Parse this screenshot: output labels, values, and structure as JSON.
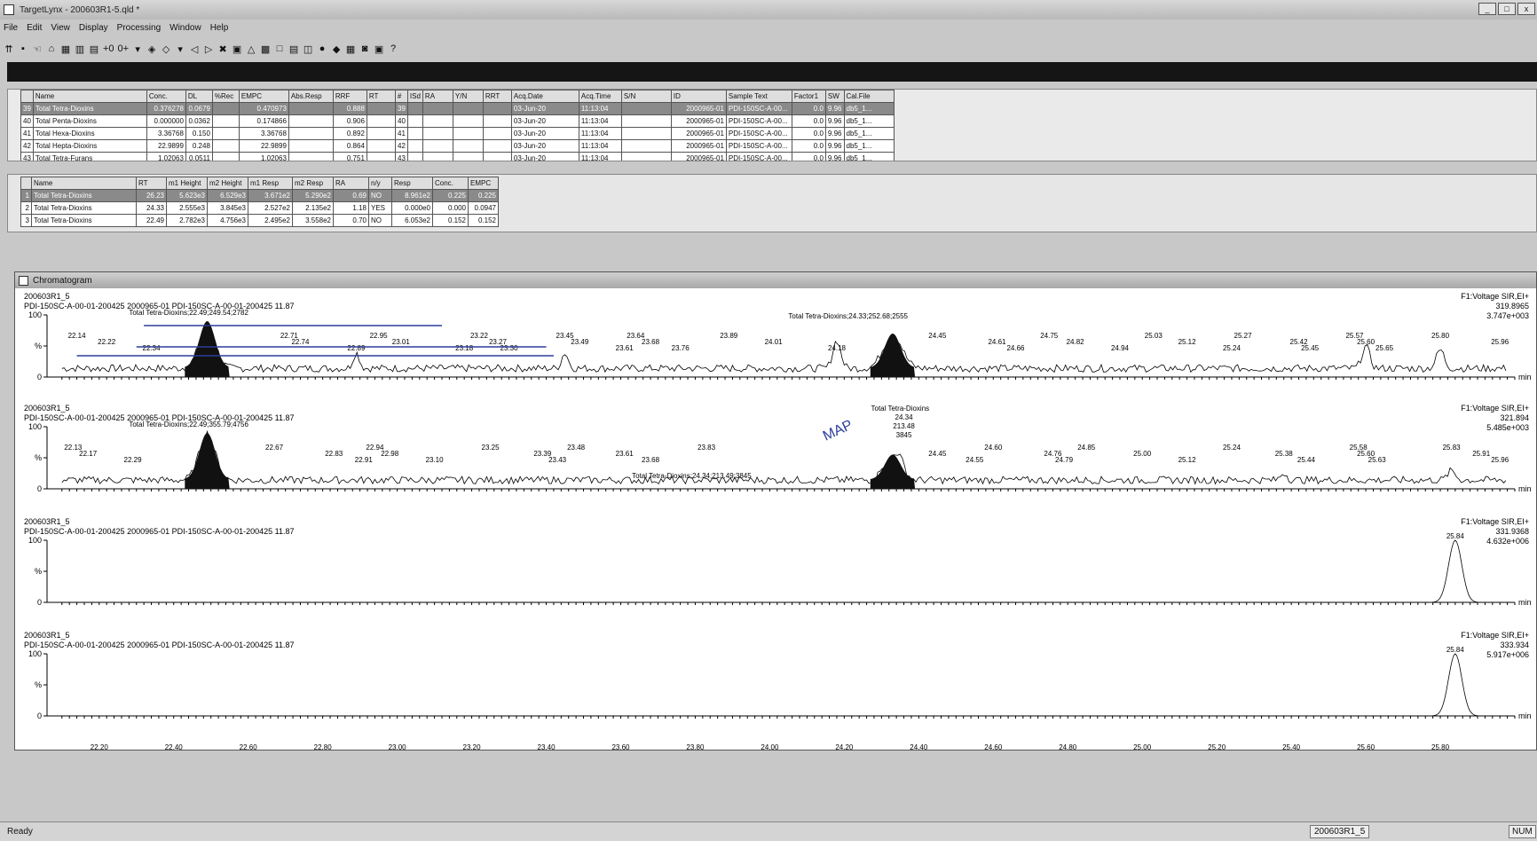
{
  "window": {
    "title": "TargetLynx - 200603R1-5.qld *",
    "controls": [
      "_",
      "□",
      "x"
    ]
  },
  "menu": [
    "File",
    "Edit",
    "View",
    "Display",
    "Processing",
    "Window",
    "Help"
  ],
  "toolbar": [
    "⇈",
    "▪",
    "☜",
    "⌂",
    "▦",
    "▥",
    "▤",
    "+0",
    "0+",
    "▾",
    "◈",
    "◇",
    "▾",
    "◁",
    "▷",
    "✖",
    "▣",
    "△",
    "▩",
    "□",
    "▤",
    "◫",
    "●",
    "◆",
    "▦",
    "◙",
    "▣",
    "?"
  ],
  "compounds_table": {
    "headers": [
      "",
      "Name",
      "Conc.",
      "DL",
      "%Rec",
      "EMPC",
      "Abs.Resp",
      "RRF",
      "RT",
      "#",
      "ISd",
      "RA",
      "Y/N",
      "RRT",
      "Acq.Date",
      "Acq.Time",
      "S/N",
      "ID",
      "Sample Text",
      "Factor1",
      "SW",
      "Cal.File"
    ],
    "rows": [
      [
        "39",
        "Total Tetra-Dioxins",
        "0.376278",
        "0.0679",
        "",
        "0.470973",
        "",
        "0.888",
        "",
        "39",
        "",
        "",
        "",
        "",
        "03-Jun-20",
        "11:13:04",
        "",
        "2000965-01",
        "PDI-150SC-A-00...",
        "0.0",
        "9.96",
        "db5_1..."
      ],
      [
        "40",
        "Total Penta-Dioxins",
        "0.000000",
        "0.0362",
        "",
        "0.174866",
        "",
        "0.906",
        "",
        "40",
        "",
        "",
        "",
        "",
        "03-Jun-20",
        "11:13:04",
        "",
        "2000965-01",
        "PDI-150SC-A-00...",
        "0.0",
        "9.96",
        "db5_1..."
      ],
      [
        "41",
        "Total Hexa-Dioxins",
        "3.36768",
        "0.150",
        "",
        "3.36768",
        "",
        "0.892",
        "",
        "41",
        "",
        "",
        "",
        "",
        "03-Jun-20",
        "11:13:04",
        "",
        "2000965-01",
        "PDI-150SC-A-00...",
        "0.0",
        "9.96",
        "db5_1..."
      ],
      [
        "42",
        "Total Hepta-Dioxins",
        "22.9899",
        "0.248",
        "",
        "22.9899",
        "",
        "0.864",
        "",
        "42",
        "",
        "",
        "",
        "",
        "03-Jun-20",
        "11:13:04",
        "",
        "2000965-01",
        "PDI-150SC-A-00...",
        "0.0",
        "9.96",
        "db5_1..."
      ],
      [
        "43",
        "Total Tetra-Furans",
        "1.02063",
        "0.0511",
        "",
        "1.02063",
        "",
        "0.751",
        "",
        "43",
        "",
        "",
        "",
        "",
        "03-Jun-20",
        "11:13:04",
        "",
        "2000965-01",
        "PDI-150SC-A-00...",
        "0.0",
        "9.96",
        "db5_1..."
      ]
    ]
  },
  "peaks_table": {
    "headers": [
      "",
      "Name",
      "RT",
      "m1 Height",
      "m2 Height",
      "m1 Resp",
      "m2 Resp",
      "RA",
      "n/y",
      "Resp",
      "Conc.",
      "EMPC"
    ],
    "rows": [
      [
        "1",
        "Total Tetra-Dioxins",
        "26.23",
        "5.623e3",
        "6.529e3",
        "3.671e2",
        "5.290e2",
        "0.69",
        "NO",
        "8.961e2",
        "0.225",
        "0.225"
      ],
      [
        "2",
        "Total Tetra-Dioxins",
        "24.33",
        "2.555e3",
        "3.845e3",
        "2.527e2",
        "2.135e2",
        "1.18",
        "YES",
        "0.000e0",
        "0.000",
        "0.0947"
      ],
      [
        "3",
        "Total Tetra-Dioxins",
        "22.49",
        "2.782e3",
        "4.756e3",
        "2.495e2",
        "3.558e2",
        "0.70",
        "NO",
        "6.053e2",
        "0.152",
        "0.152"
      ]
    ]
  },
  "chromatogram": {
    "window_title": "Chromatogram",
    "x_axis": {
      "ticks": [
        "22.20",
        "22.40",
        "22.60",
        "22.80",
        "23.00",
        "23.20",
        "23.40",
        "23.60",
        "23.80",
        "24.00",
        "24.20",
        "24.40",
        "24.60",
        "24.80",
        "25.00",
        "25.20",
        "25.40",
        "25.60",
        "25.80"
      ],
      "unit": "min"
    },
    "y_ticks": [
      "100",
      "%",
      "0"
    ],
    "traces": [
      {
        "sample": "200603R1_5",
        "desc": "PDI-150SC-A-00-01-200425 2000965-01 PDI-150SC-A-00-01-200425 11.87",
        "function": "F1:Voltage SIR,EI+",
        "mass": "319.8965",
        "intensity": "3.747e+003",
        "annotation_left": "Total Tetra-Dioxins;22.49;249.54;2782",
        "annotation_right": "Total Tetra-Dioxins;24.33;252.68;2555",
        "peak_labels": [
          "22.14",
          "22.22",
          "22.34",
          "22.71",
          "22.74",
          "22.89",
          "22.95",
          "23.01",
          "23.18",
          "23.22",
          "23.27",
          "23.30",
          "23.45",
          "23.49",
          "23.61",
          "23.64",
          "23.68",
          "23.76",
          "23.89",
          "24.01",
          "24.18",
          "24.45",
          "24.61",
          "24.66",
          "24.75",
          "24.82",
          "24.94",
          "25.03",
          "25.12",
          "25.24",
          "25.27",
          "25.42",
          "25.45",
          "25.57",
          "25.60",
          "25.65",
          "25.80",
          "25.96"
        ]
      },
      {
        "sample": "200603R1_5",
        "desc": "PDI-150SC-A-00-01-200425 2000965-01 PDI-150SC-A-00-01-200425 11.87",
        "function": "F1:Voltage SIR,EI+",
        "mass": "321.894",
        "intensity": "5.485e+003",
        "annotation_left": "Total Tetra-Dioxins;22.49;355.79;4756",
        "annotation_right": "Total Tetra-Dioxins;24.34;213.49;3845",
        "annotation_top": "Total Tetra-Dioxins",
        "annotation_top_values": [
          "24.34",
          "213.48",
          "3845"
        ],
        "handwritten": "MAP",
        "peak_labels": [
          "22.13",
          "22.17",
          "22.29",
          "22.67",
          "22.83",
          "22.91",
          "22.94",
          "22.98",
          "23.10",
          "23.25",
          "23.39",
          "23.43",
          "23.48",
          "23.61",
          "23.68",
          "23.83",
          "24.45",
          "24.55",
          "24.60",
          "24.76",
          "24.79",
          "24.85",
          "25.00",
          "25.12",
          "25.24",
          "25.38",
          "25.44",
          "25.58",
          "25.60",
          "25.63",
          "25.83",
          "25.91",
          "25.96"
        ]
      },
      {
        "sample": "200603R1_5",
        "desc": "PDI-150SC-A-00-01-200425 2000965-01 PDI-150SC-A-00-01-200425 11.87",
        "function": "F1:Voltage SIR,EI+",
        "mass": "331.9368",
        "intensity": "4.632e+006",
        "peak_labels": [
          "25.84"
        ]
      },
      {
        "sample": "200603R1_5",
        "desc": "PDI-150SC-A-00-01-200425 2000965-01 PDI-150SC-A-00-01-200425 11.87",
        "function": "F1:Voltage SIR,EI+",
        "mass": "333.934",
        "intensity": "5.917e+006",
        "peak_labels": [
          "25.84"
        ]
      }
    ]
  },
  "status": {
    "ready": "Ready",
    "file": "200603R1_5",
    "num": "NUM"
  }
}
